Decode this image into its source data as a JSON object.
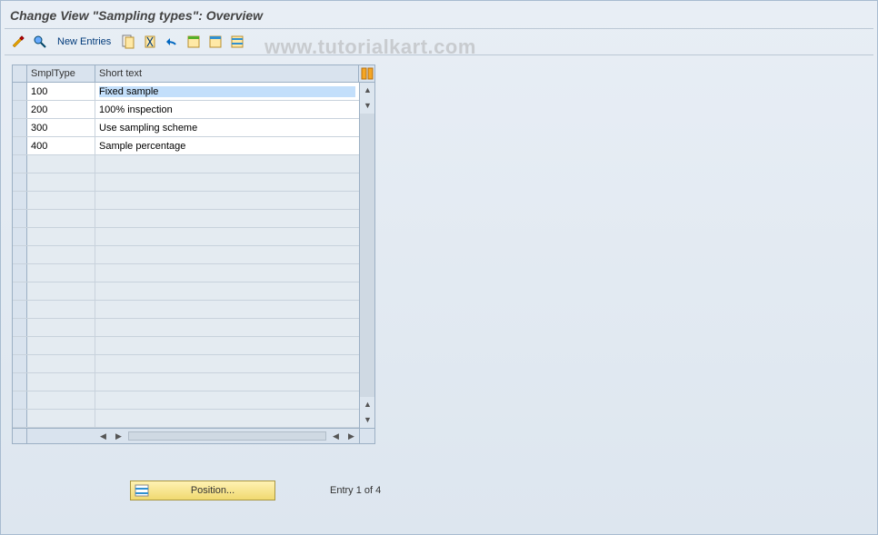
{
  "title": "Change View \"Sampling types\": Overview",
  "toolbar": {
    "new_entries_label": "New Entries"
  },
  "watermark": "www.tutorialkart.com",
  "grid": {
    "columns": {
      "c1": "SmplType",
      "c2": "Short text"
    },
    "rows": [
      {
        "type": "100",
        "text": "Fixed sample"
      },
      {
        "type": "200",
        "text": "100% inspection"
      },
      {
        "type": "300",
        "text": "Use sampling scheme"
      },
      {
        "type": "400",
        "text": "Sample percentage"
      }
    ],
    "empty_rows": 15
  },
  "footer": {
    "position_label": "Position...",
    "entry_status": "Entry 1 of 4"
  }
}
